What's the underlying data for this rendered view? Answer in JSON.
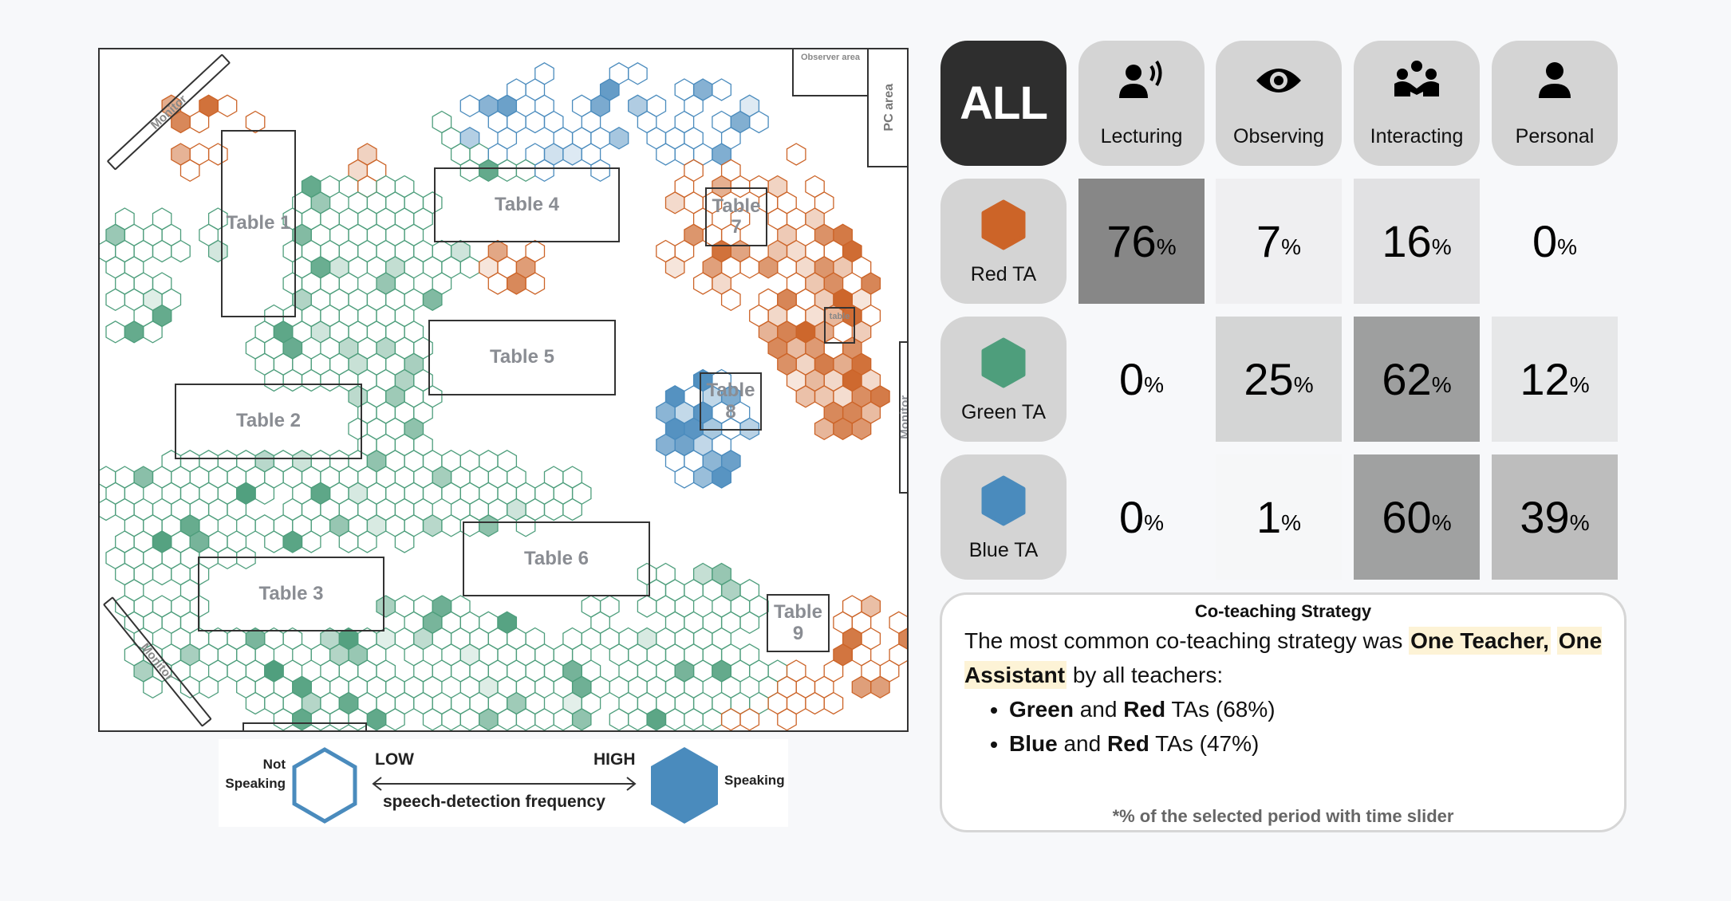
{
  "map": {
    "tables": [
      "Table 1",
      "Table 2",
      "Table 3",
      "Table 4",
      "Table 5",
      "Table 6",
      "Table 7",
      "Table 8",
      "Table 9"
    ],
    "small_table": "table",
    "observer_area": "Observer area",
    "pc_area": "PC area",
    "monitor_label": "Monitor",
    "colors": {
      "red": "#cc6428",
      "green": "#4e9e7c",
      "blue": "#4a8bbd"
    }
  },
  "legend": {
    "not_speaking": [
      "Not",
      "Speaking"
    ],
    "low": "LOW",
    "high": "HIGH",
    "axis": "speech-detection frequency",
    "speaking": "Speaking"
  },
  "header": {
    "all": "ALL",
    "categories": [
      {
        "label": "Lecturing",
        "icon": "lecturing-icon"
      },
      {
        "label": "Observing",
        "icon": "eye-icon"
      },
      {
        "label": "Interacting",
        "icon": "group-icon"
      },
      {
        "label": "Personal",
        "icon": "person-icon"
      }
    ]
  },
  "rows": [
    {
      "label": "Red TA",
      "color": "#cc6428",
      "values": [
        "76",
        "7",
        "16",
        "0"
      ],
      "shades": [
        "#878787",
        "#efeff1",
        "#e1e1e3",
        "transparent"
      ]
    },
    {
      "label": "Green TA",
      "color": "#4e9e7c",
      "values": [
        "0",
        "25",
        "62",
        "12"
      ],
      "shades": [
        "transparent",
        "#d4d5d5",
        "#9e9f9f",
        "#e6e7e8"
      ]
    },
    {
      "label": "Blue TA",
      "color": "#4a8bbd",
      "values": [
        "0",
        "1",
        "60",
        "39"
      ],
      "shades": [
        "transparent",
        "#f6f7f8",
        "#a0a1a1",
        "#bdbdbd"
      ]
    }
  ],
  "percent_sign": "%",
  "strategy": {
    "title": "Co-teaching Strategy",
    "intro": "The most common co-teaching strategy was",
    "highlight1": "One Teacher,",
    "highlight2": "One Assistant",
    "intro_end": "by all teachers:",
    "items": [
      {
        "a": "Green",
        "and": "and",
        "b": "Red",
        "rest": "TAs (68%)"
      },
      {
        "a": "Blue",
        "and": "and",
        "b": "Red",
        "rest": "TAs (47%)"
      }
    ],
    "footnote": "*% of the selected period with time slider"
  }
}
